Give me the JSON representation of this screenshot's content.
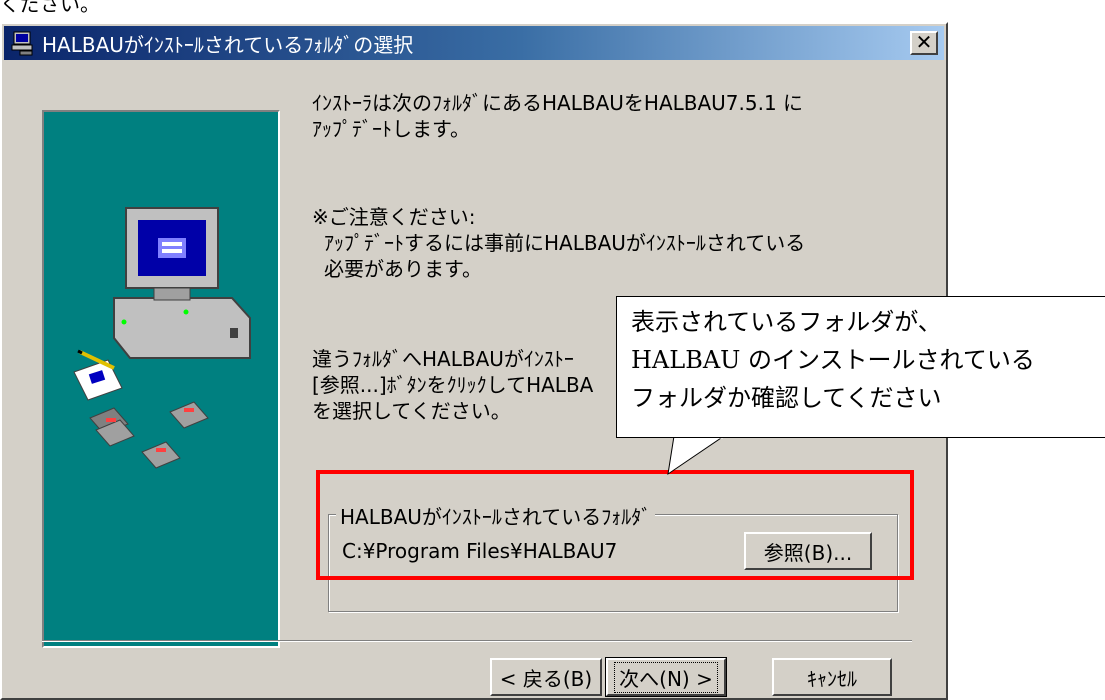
{
  "page_fragment_text": "ください。",
  "window": {
    "title": "HALBAUがｲﾝｽﾄｰﾙされているﾌｫﾙﾀﾞの選択",
    "close_glyph": "✕"
  },
  "content": {
    "intro_line1": "ｲﾝｽﾄｰﾗは次のﾌｫﾙﾀﾞにあるHALBAUをHALBAU7.5.1 に",
    "intro_line2": "ｱｯﾌﾟﾃﾞｰﾄします。",
    "note_line1": "※ご注意ください:",
    "note_line2": "ｱｯﾌﾟﾃﾞｰﾄするには事前にHALBAUがｲﾝｽﾄｰﾙされている",
    "note_line3": "必要があります。",
    "other_line1": "違うﾌｫﾙﾀﾞへHALBAUがｲﾝｽﾄｰ",
    "other_line2": "[参照...]ﾎﾞﾀﾝをｸﾘｯｸしてHALBA",
    "other_line3": "を選択してください。"
  },
  "folder_group": {
    "legend": "HALBAUがｲﾝｽﾄｰﾙされているﾌｫﾙﾀﾞ",
    "path": "C:¥Program Files¥HALBAU7",
    "browse_label": "参照(B)..."
  },
  "buttons": {
    "back_label": "< 戻る(B)",
    "next_label": "次へ(N) >",
    "cancel_label": "ｷｬﾝｾﾙ"
  },
  "callout": {
    "line1": "表示されているフォルダが、",
    "line2": "HALBAU のインストールされている",
    "line3": "フォルダか確認してください"
  },
  "colors": {
    "title_gradient_start": "#0a246a",
    "art_background": "#008080",
    "highlight_box": "#ff0000"
  }
}
